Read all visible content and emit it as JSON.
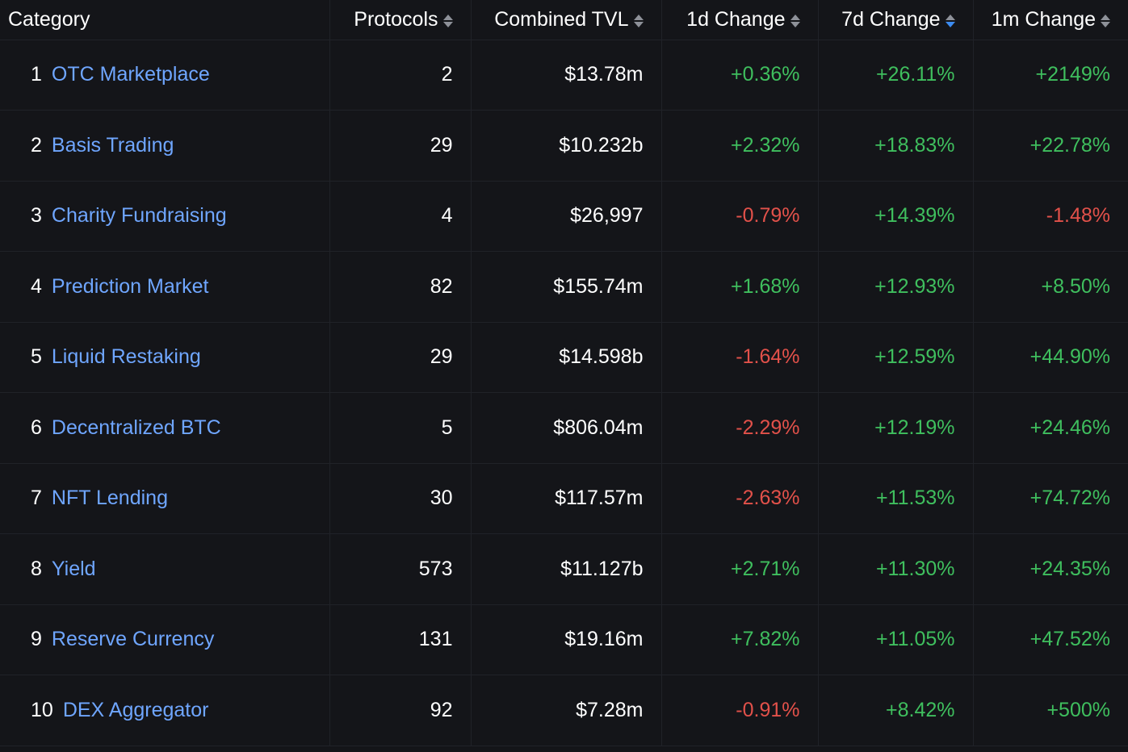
{
  "colors": {
    "background": "#141519",
    "link": "#6fa6ff",
    "positive": "#3fbf5e",
    "negative": "#e2514a",
    "sort_active": "#3c8bf0"
  },
  "headers": {
    "category": "Category",
    "protocols": "Protocols",
    "tvl": "Combined TVL",
    "d1": "1d Change",
    "d7": "7d Change",
    "m1": "1m Change",
    "active_sort": "7d Change"
  },
  "rows": [
    {
      "rank": "1",
      "category": "OTC Marketplace",
      "protocols": "2",
      "tvl": "$13.78m",
      "d1": "+0.36%",
      "d7": "+26.11%",
      "m1": "+2149%"
    },
    {
      "rank": "2",
      "category": "Basis Trading",
      "protocols": "29",
      "tvl": "$10.232b",
      "d1": "+2.32%",
      "d7": "+18.83%",
      "m1": "+22.78%"
    },
    {
      "rank": "3",
      "category": "Charity Fundraising",
      "protocols": "4",
      "tvl": "$26,997",
      "d1": "-0.79%",
      "d7": "+14.39%",
      "m1": "-1.48%"
    },
    {
      "rank": "4",
      "category": "Prediction Market",
      "protocols": "82",
      "tvl": "$155.74m",
      "d1": "+1.68%",
      "d7": "+12.93%",
      "m1": "+8.50%"
    },
    {
      "rank": "5",
      "category": "Liquid Restaking",
      "protocols": "29",
      "tvl": "$14.598b",
      "d1": "-1.64%",
      "d7": "+12.59%",
      "m1": "+44.90%"
    },
    {
      "rank": "6",
      "category": "Decentralized BTC",
      "protocols": "5",
      "tvl": "$806.04m",
      "d1": "-2.29%",
      "d7": "+12.19%",
      "m1": "+24.46%"
    },
    {
      "rank": "7",
      "category": "NFT Lending",
      "protocols": "30",
      "tvl": "$117.57m",
      "d1": "-2.63%",
      "d7": "+11.53%",
      "m1": "+74.72%"
    },
    {
      "rank": "8",
      "category": "Yield",
      "protocols": "573",
      "tvl": "$11.127b",
      "d1": "+2.71%",
      "d7": "+11.30%",
      "m1": "+24.35%"
    },
    {
      "rank": "9",
      "category": "Reserve Currency",
      "protocols": "131",
      "tvl": "$19.16m",
      "d1": "+7.82%",
      "d7": "+11.05%",
      "m1": "+47.52%"
    },
    {
      "rank": "10",
      "category": "DEX Aggregator",
      "protocols": "92",
      "tvl": "$7.28m",
      "d1": "-0.91%",
      "d7": "+8.42%",
      "m1": "+500%"
    }
  ]
}
